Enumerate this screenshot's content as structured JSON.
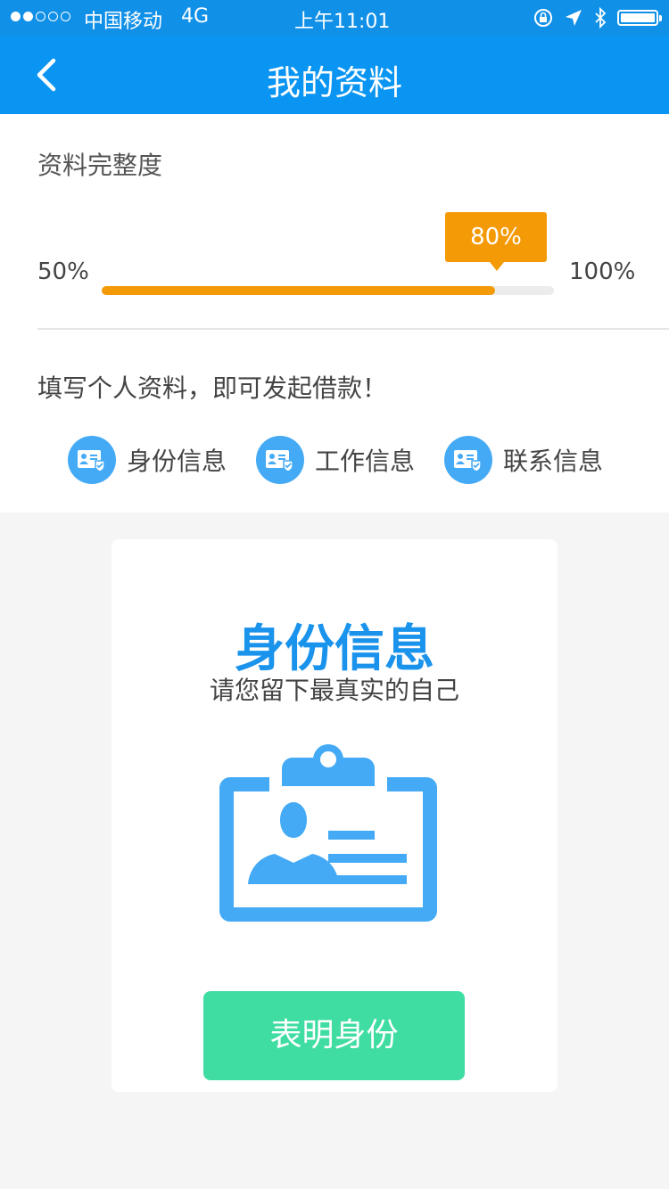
{
  "status_bar": {
    "carrier": "中国移动",
    "network": "4G",
    "time": "上午11:01",
    "signal_bars_filled": 2,
    "signal_bars_total": 5
  },
  "navbar": {
    "title": "我的资料",
    "back_icon": "chevron-left-icon"
  },
  "completeness": {
    "label": "资料完整度",
    "min_label": "50%",
    "max_label": "100%",
    "current_label": "80%",
    "progress_fraction": 0.87,
    "accent_color": "#f49a06"
  },
  "prompt": "填写个人资料，即可发起借款！",
  "steps": [
    {
      "label": "身份信息",
      "icon": "id-card-check-icon"
    },
    {
      "label": "工作信息",
      "icon": "id-card-check-icon"
    },
    {
      "label": "联系信息",
      "icon": "id-card-check-icon"
    }
  ],
  "card": {
    "title": "身份信息",
    "subtitle": "请您留下最真实的自己",
    "illustration": "id-badge-icon",
    "button_label": "表明身份",
    "button_color": "#3fdda2",
    "title_color": "#1a93ec"
  },
  "colors": {
    "brand_blue": "#0a95f2",
    "status_blue": "#1190e8",
    "icon_blue": "#44aaf5"
  }
}
